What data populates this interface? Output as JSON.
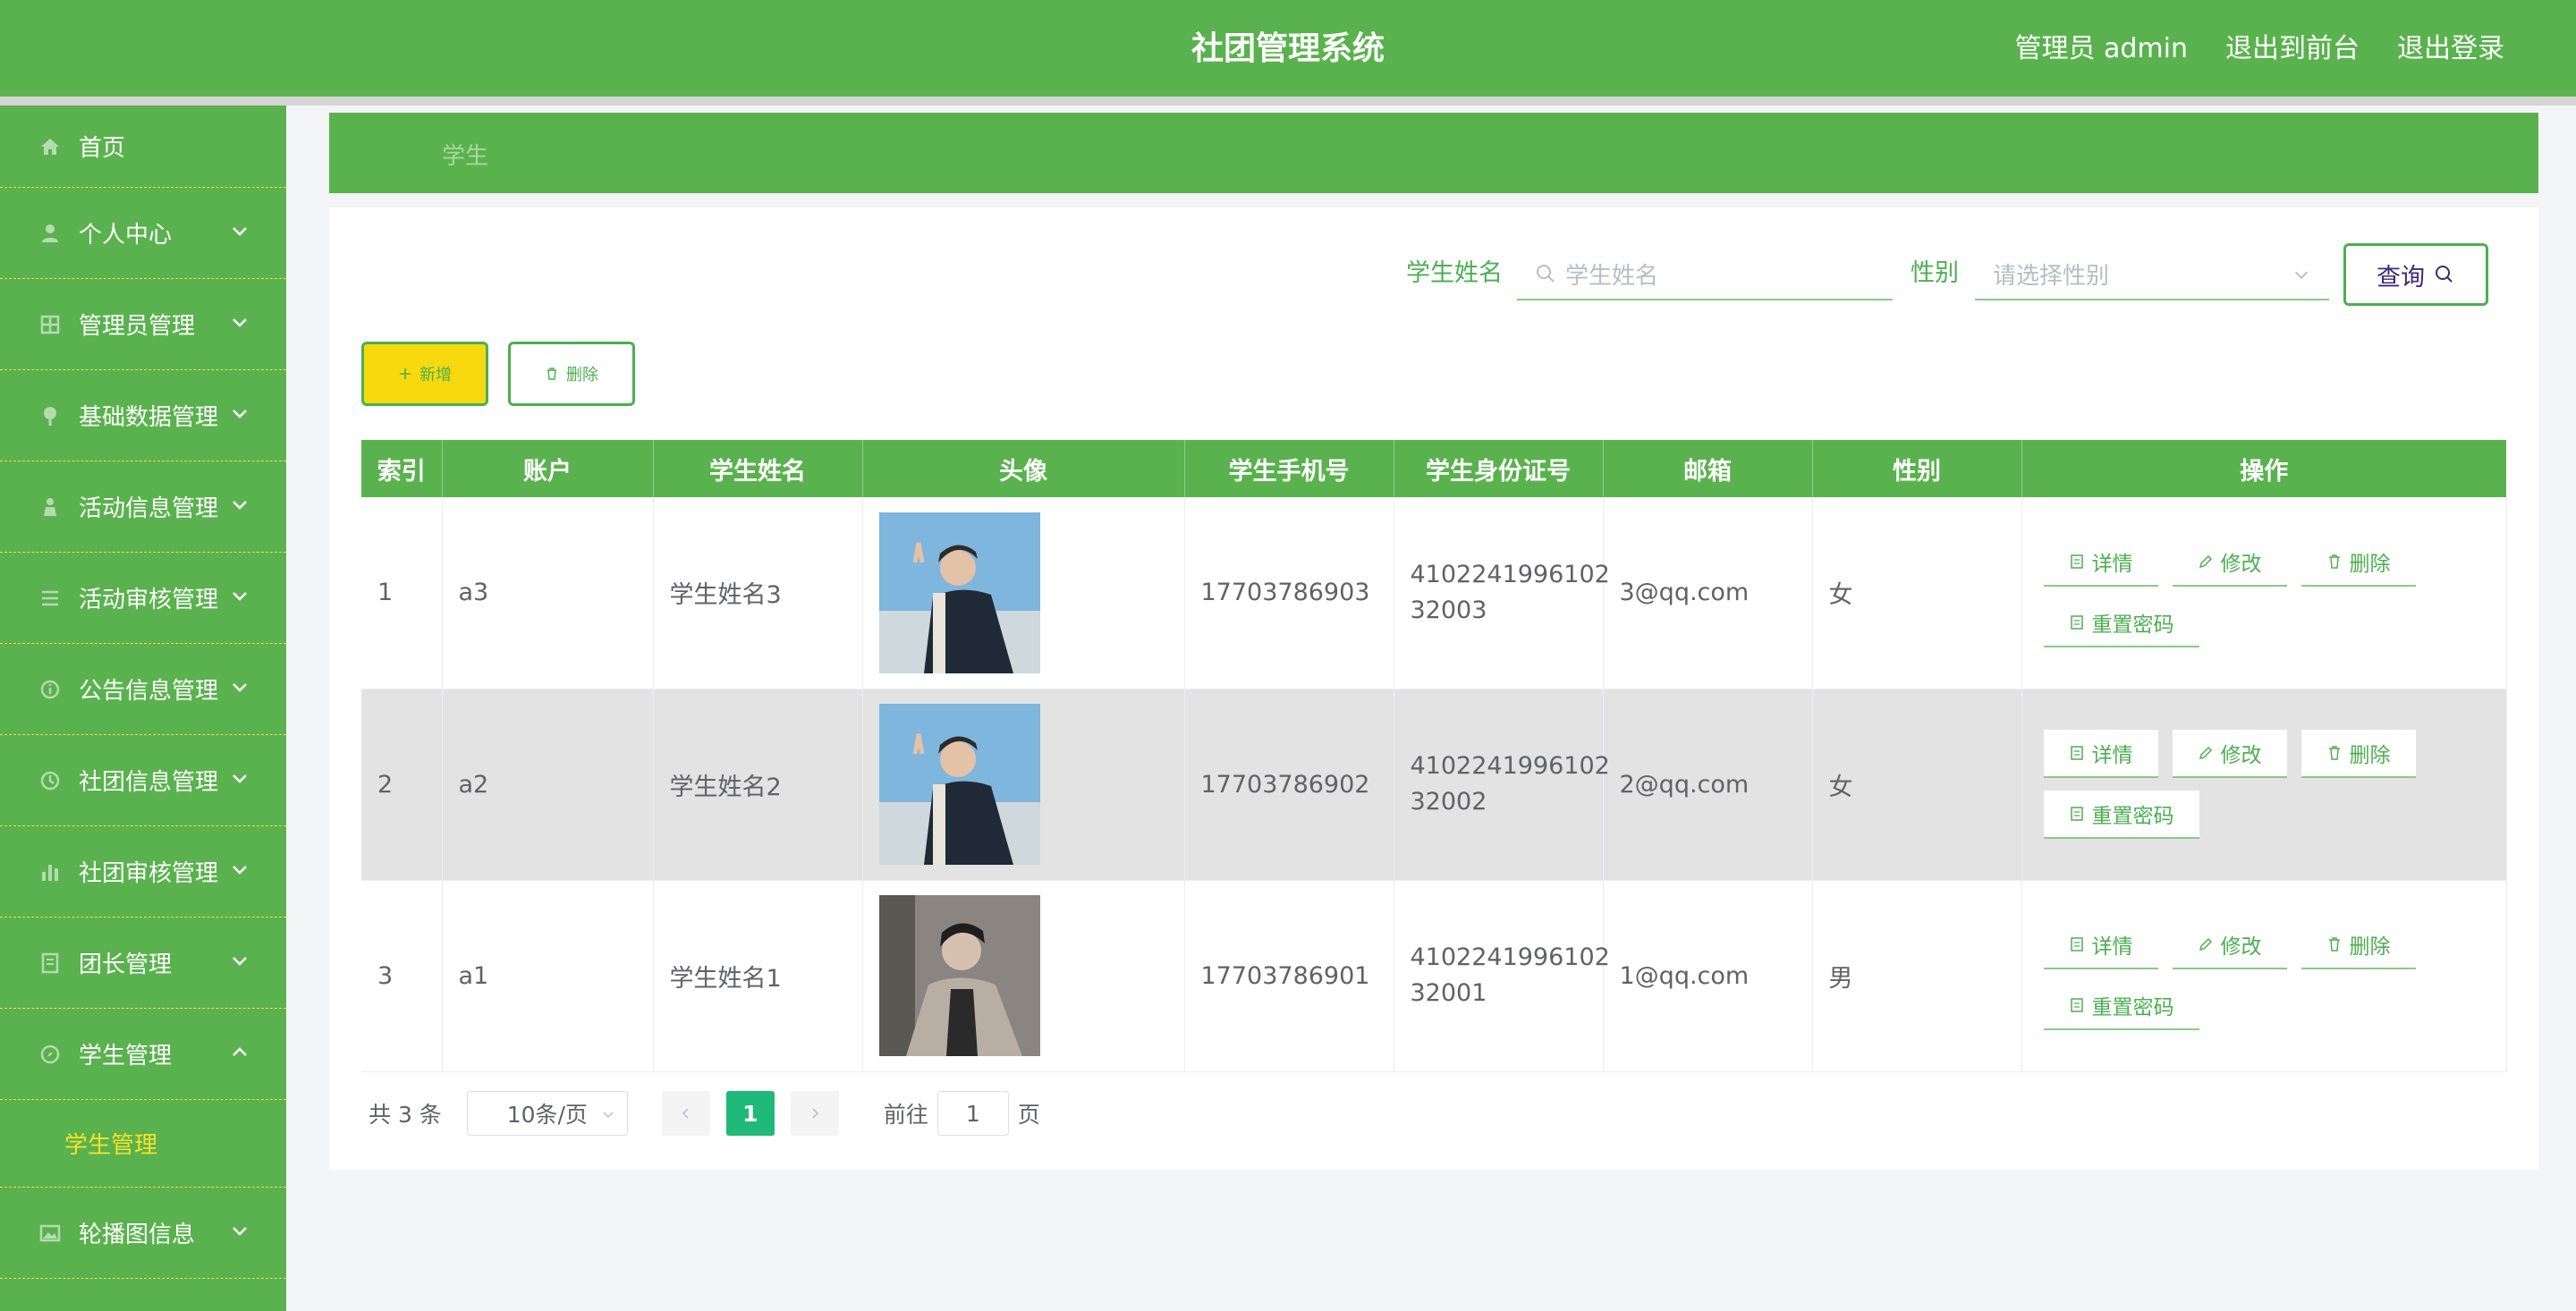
{
  "header": {
    "title": "社团管理系统",
    "admin_label": "管理员 admin",
    "to_front": "退出到前台",
    "logout": "退出登录"
  },
  "sidebar": {
    "items": [
      {
        "label": "首页",
        "icon": "home-icon"
      },
      {
        "label": "个人中心",
        "icon": "user-icon"
      },
      {
        "label": "管理员管理",
        "icon": "grid-icon"
      },
      {
        "label": "基础数据管理",
        "icon": "pin-icon"
      },
      {
        "label": "活动信息管理",
        "icon": "person-icon"
      },
      {
        "label": "活动审核管理",
        "icon": "list-icon"
      },
      {
        "label": "公告信息管理",
        "icon": "info-icon"
      },
      {
        "label": "社团信息管理",
        "icon": "clock-icon"
      },
      {
        "label": "社团审核管理",
        "icon": "chart-icon"
      },
      {
        "label": "团长管理",
        "icon": "doc-icon"
      },
      {
        "label": "学生管理",
        "icon": "compass-icon"
      },
      {
        "label": "轮播图信息",
        "icon": "image-icon"
      }
    ],
    "active_sub": "学生管理"
  },
  "breadcrumb": {
    "current": "学生"
  },
  "search": {
    "name_label": "学生姓名",
    "name_placeholder": "学生姓名",
    "gender_label": "性别",
    "gender_placeholder": "请选择性别",
    "query_button": "查询"
  },
  "actions": {
    "add": "新增",
    "delete": "删除"
  },
  "table": {
    "columns": [
      "索引",
      "账户",
      "学生姓名",
      "头像",
      "学生手机号",
      "学生身份证号",
      "邮箱",
      "性别",
      "操作"
    ],
    "rows": [
      {
        "index": "1",
        "account": "a3",
        "name": "学生姓名3",
        "phone": "17703786903",
        "id_line1": "4102241996102",
        "id_line2": "32003",
        "email": "3@qq.com",
        "gender": "女"
      },
      {
        "index": "2",
        "account": "a2",
        "name": "学生姓名2",
        "phone": "17703786902",
        "id_line1": "4102241996102",
        "id_line2": "32002",
        "email": "2@qq.com",
        "gender": "女"
      },
      {
        "index": "3",
        "account": "a1",
        "name": "学生姓名1",
        "phone": "17703786901",
        "id_line1": "4102241996102",
        "id_line2": "32001",
        "email": "1@qq.com",
        "gender": "男"
      }
    ],
    "ops": {
      "detail": "详情",
      "edit": "修改",
      "delete": "删除",
      "reset": "重置密码"
    }
  },
  "pagination": {
    "total": "共 3 条",
    "page_size": "10条/页",
    "current_page": "1",
    "goto_label": "前往",
    "goto_value": "1",
    "page_suffix": "页"
  },
  "colors": {
    "primary": "#5ab24e",
    "accent_yellow": "#f7d90f",
    "active_page": "#1fb97a"
  }
}
